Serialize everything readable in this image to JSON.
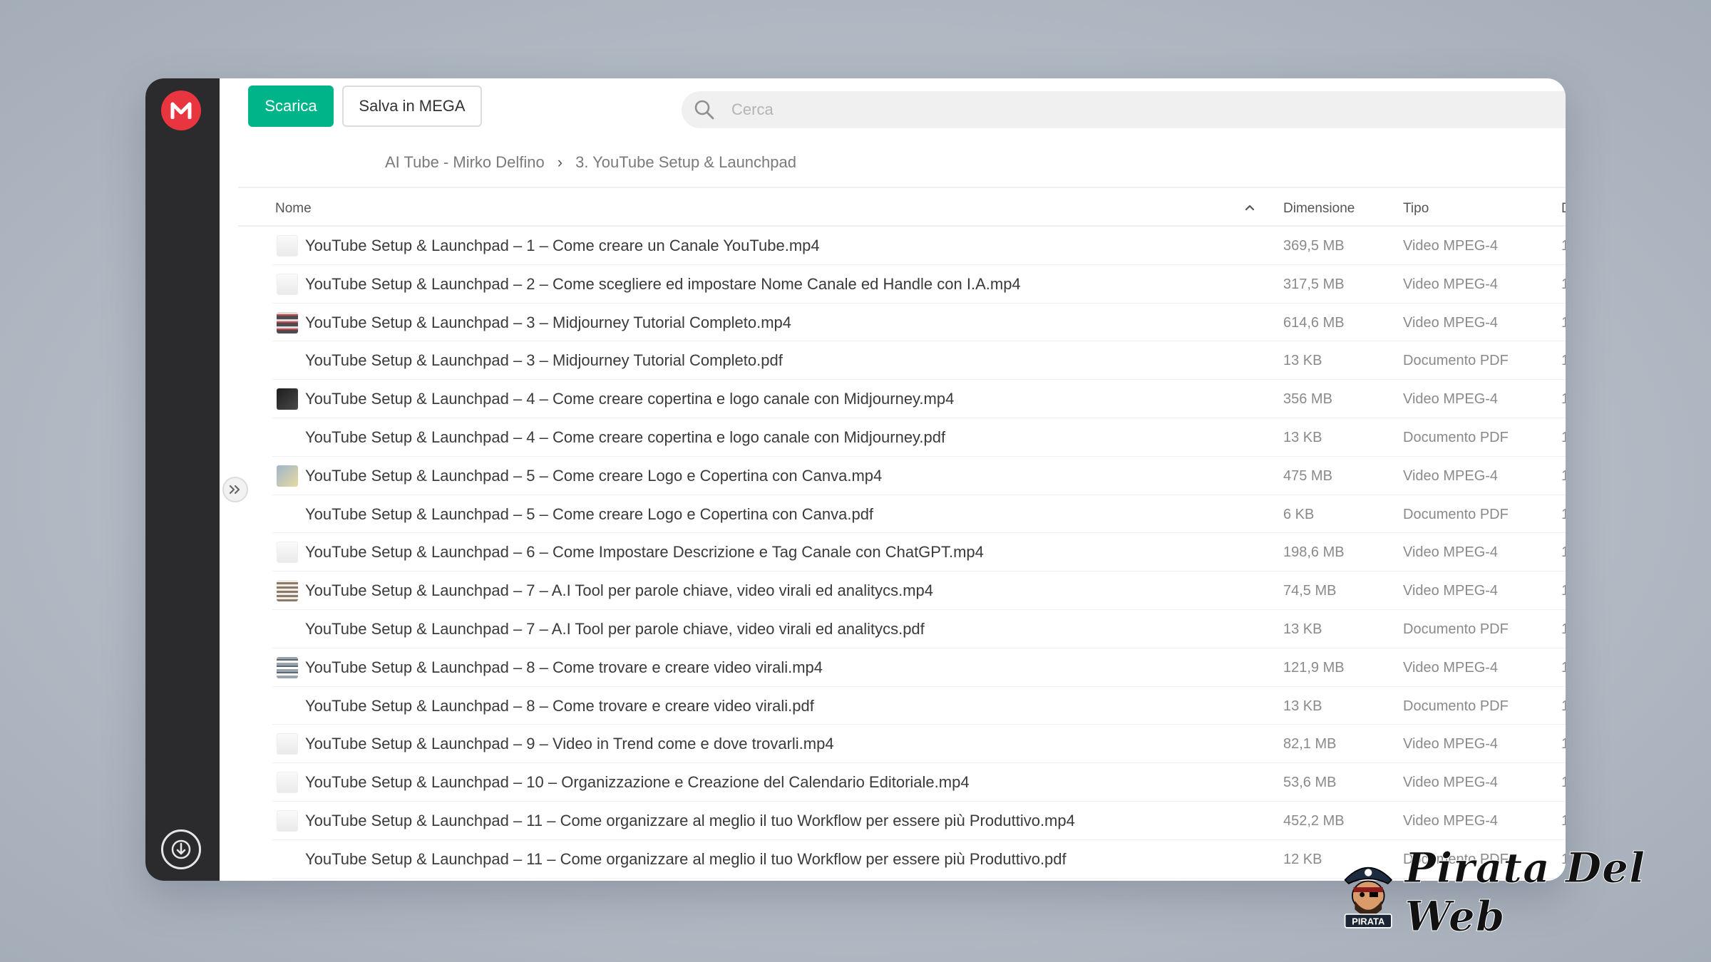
{
  "toolbar": {
    "download_label": "Scarica",
    "save_label": "Salva in MEGA"
  },
  "search": {
    "placeholder": "Cerca"
  },
  "breadcrumb": {
    "items": [
      "AI Tube - Mirko Delfino",
      "3. YouTube Setup & Launchpad"
    ]
  },
  "table": {
    "columns": {
      "name": "Nome",
      "size": "Dimensione",
      "type": "Tipo",
      "edge": "D"
    },
    "rows": [
      {
        "name": "YouTube Setup & Launchpad – 1 – Come creare un Canale YouTube.mp4",
        "size": "369,5 MB",
        "type": "Video MPEG-4",
        "thumb": "light"
      },
      {
        "name": "YouTube Setup & Launchpad – 2 – Come scegliere ed impostare Nome Canale ed Handle con I.A.mp4",
        "size": "317,5 MB",
        "type": "Video MPEG-4",
        "thumb": "light"
      },
      {
        "name": "YouTube Setup & Launchpad – 3 – Midjourney Tutorial Completo.mp4",
        "size": "614,6 MB",
        "type": "Video MPEG-4",
        "thumb": "multi"
      },
      {
        "name": "YouTube Setup & Launchpad – 3 – Midjourney Tutorial Completo.pdf",
        "size": "13 KB",
        "type": "Documento PDF",
        "thumb": "blank"
      },
      {
        "name": "YouTube Setup & Launchpad – 4 – Come creare copertina e logo canale con Midjourney.mp4",
        "size": "356 MB",
        "type": "Video MPEG-4",
        "thumb": "dark2"
      },
      {
        "name": "YouTube Setup & Launchpad – 4 – Come creare copertina e logo canale con Midjourney.pdf",
        "size": "13 KB",
        "type": "Documento PDF",
        "thumb": "blank"
      },
      {
        "name": "YouTube Setup & Launchpad – 5 – Come creare Logo e Copertina con Canva.mp4",
        "size": "475 MB",
        "type": "Video MPEG-4",
        "thumb": "blue"
      },
      {
        "name": "YouTube Setup & Launchpad – 5 – Come creare Logo e Copertina con Canva.pdf",
        "size": "6 KB",
        "type": "Documento PDF",
        "thumb": "blank"
      },
      {
        "name": "YouTube Setup & Launchpad – 6 – Come Impostare Descrizione e Tag Canale con ChatGPT.mp4",
        "size": "198,6 MB",
        "type": "Video MPEG-4",
        "thumb": "light"
      },
      {
        "name": "YouTube Setup & Launchpad – 7 – A.I Tool per parole chiave, video virali ed analitycs.mp4",
        "size": "74,5 MB",
        "type": "Video MPEG-4",
        "thumb": "grid"
      },
      {
        "name": "YouTube Setup & Launchpad – 7 – A.I Tool per parole chiave, video virali ed analitycs.pdf",
        "size": "13 KB",
        "type": "Documento PDF",
        "thumb": "blank"
      },
      {
        "name": "YouTube Setup & Launchpad – 8 – Come trovare e creare video virali.mp4",
        "size": "121,9 MB",
        "type": "Video MPEG-4",
        "thumb": "bars"
      },
      {
        "name": "YouTube Setup & Launchpad – 8 – Come trovare e creare video virali.pdf",
        "size": "13 KB",
        "type": "Documento PDF",
        "thumb": "blank"
      },
      {
        "name": "YouTube Setup & Launchpad – 9 – Video in Trend come e dove trovarli.mp4",
        "size": "82,1 MB",
        "type": "Video MPEG-4",
        "thumb": "light"
      },
      {
        "name": "YouTube Setup & Launchpad – 10 – Organizzazione e Creazione del Calendario Editoriale.mp4",
        "size": "53,6 MB",
        "type": "Video MPEG-4",
        "thumb": "light"
      },
      {
        "name": "YouTube Setup & Launchpad – 11 – Come organizzare al meglio il tuo Workflow per essere più Produttivo.mp4",
        "size": "452,2 MB",
        "type": "Video MPEG-4",
        "thumb": "light"
      },
      {
        "name": "YouTube Setup & Launchpad – 11 – Come organizzare al meglio il tuo Workflow per essere più Produttivo.pdf",
        "size": "12 KB",
        "type": "Documento PDF",
        "thumb": "blank"
      }
    ]
  },
  "watermark": {
    "brand": "Pirata Del Web",
    "badge": "PIRATA"
  },
  "colors": {
    "primary": "#00b48a",
    "mega_red": "#e9353f",
    "sidebar": "#2b2b2e"
  },
  "icons": {
    "logo": "mega-logo-icon",
    "search": "search-icon",
    "expand": "chevron-double-right-icon",
    "sort": "sort-ascending-icon",
    "bottom": "transfer-icon"
  }
}
